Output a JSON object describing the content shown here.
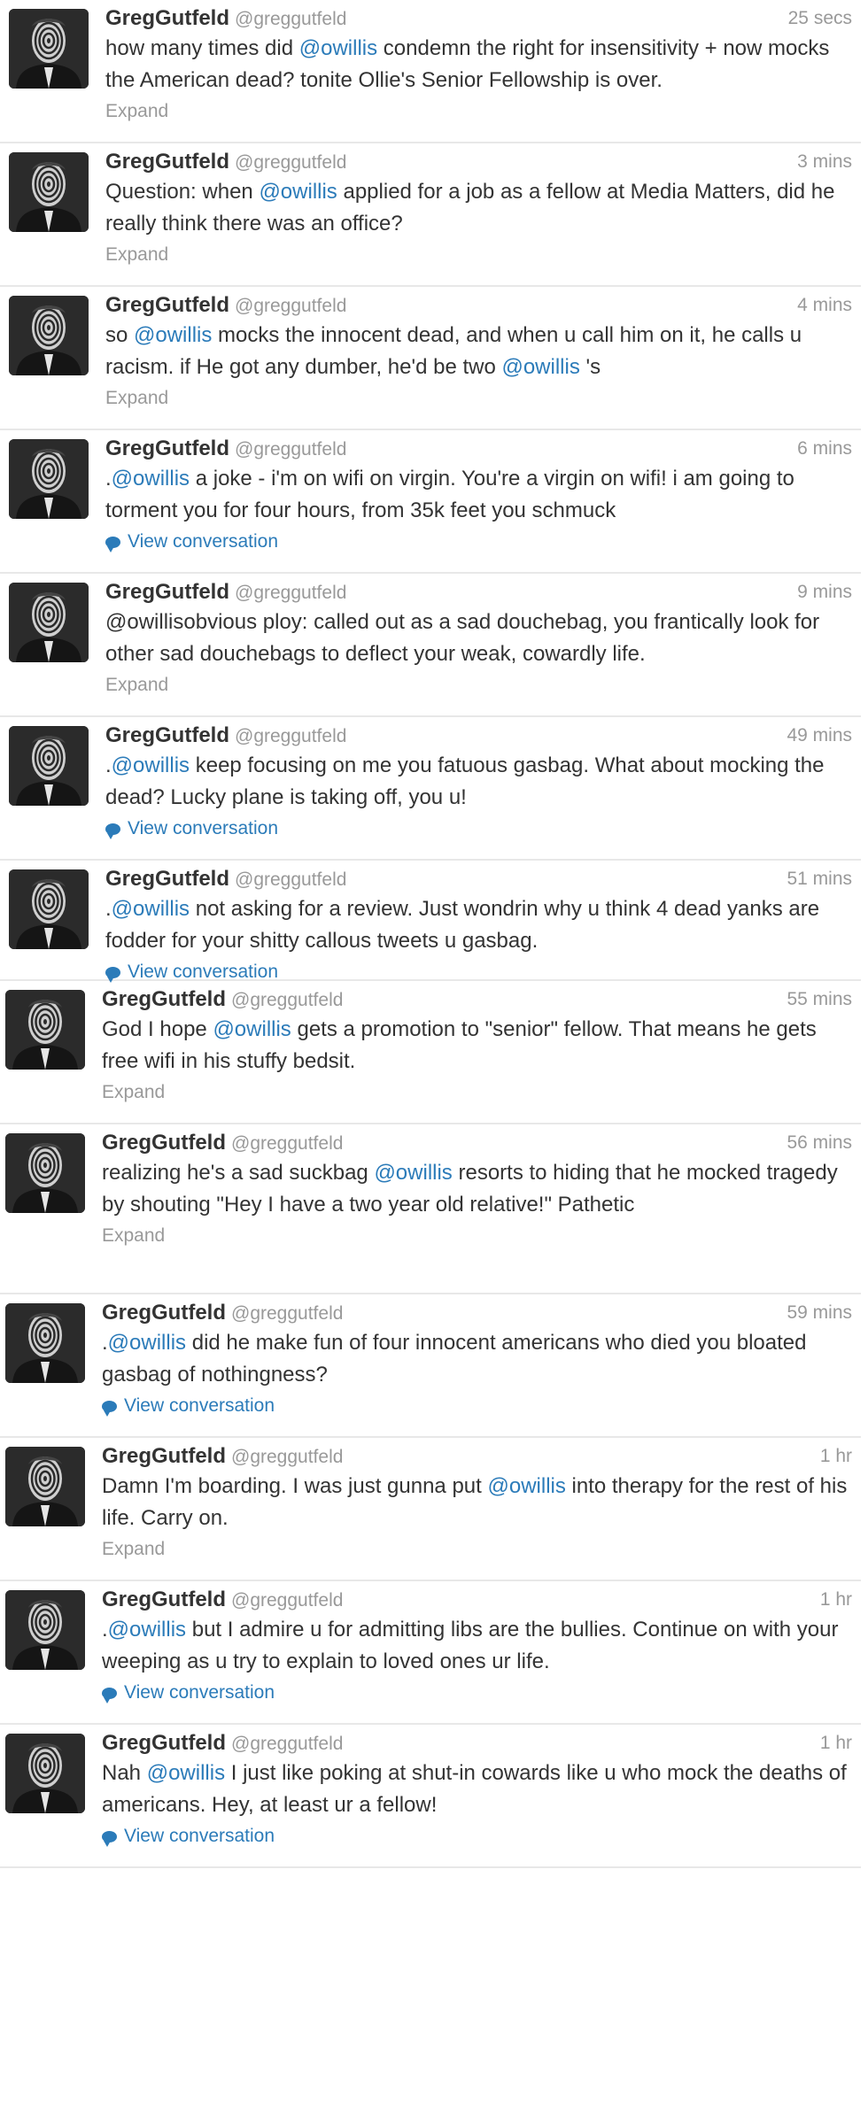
{
  "icons": {
    "avatar": "greg-gutfeld-hypnotic-portrait",
    "conversation": "speech-bubble-icon"
  },
  "colors": {
    "link": "#2b7bb9",
    "muted": "#999999",
    "text": "#333333"
  },
  "tweets": [
    {
      "name": "GregGutfeld",
      "handle": "@greggutfeld",
      "time": "25 secs",
      "segments": [
        {
          "t": "text",
          "v": "how many times did "
        },
        {
          "t": "mention",
          "v": "@owillis"
        },
        {
          "t": "text",
          "v": " condemn the right for insensitivity + now mocks the American dead? tonite Ollie's Senior Fellowship is over."
        }
      ],
      "action": "Expand",
      "action_type": "expand"
    },
    {
      "name": "GregGutfeld",
      "handle": "@greggutfeld",
      "time": "3 mins",
      "segments": [
        {
          "t": "text",
          "v": "Question: when "
        },
        {
          "t": "mention",
          "v": "@owillis"
        },
        {
          "t": "text",
          "v": " applied for a job as a fellow at Media Matters, did he really think there was an office?"
        }
      ],
      "action": "Expand",
      "action_type": "expand"
    },
    {
      "name": "GregGutfeld",
      "handle": "@greggutfeld",
      "time": "4 mins",
      "segments": [
        {
          "t": "text",
          "v": "so "
        },
        {
          "t": "mention",
          "v": "@owillis"
        },
        {
          "t": "text",
          "v": " mocks the innocent dead, and when u call him on it, he calls u racism. if He got any dumber, he'd be two "
        },
        {
          "t": "mention",
          "v": "@owillis"
        },
        {
          "t": "text",
          "v": " 's"
        }
      ],
      "action": "Expand",
      "action_type": "expand"
    },
    {
      "name": "GregGutfeld",
      "handle": "@greggutfeld",
      "time": "6 mins",
      "segments": [
        {
          "t": "text",
          "v": "."
        },
        {
          "t": "mention",
          "v": "@owillis"
        },
        {
          "t": "text",
          "v": " a joke - i'm on wifi on virgin. You're a virgin on wifi! i am going to torment you for four hours, from 35k feet you schmuck"
        }
      ],
      "action": "View conversation",
      "action_type": "conversation"
    },
    {
      "name": "GregGutfeld",
      "handle": "@greggutfeld",
      "time": "9 mins",
      "segments": [
        {
          "t": "text",
          "v": "@owillisobvious ploy: called out as a sad douchebag, you frantically look for other sad douchebags to deflect your weak, cowardly life."
        }
      ],
      "action": "Expand",
      "action_type": "expand"
    },
    {
      "name": "GregGutfeld",
      "handle": "@greggutfeld",
      "time": "49 mins",
      "segments": [
        {
          "t": "text",
          "v": "."
        },
        {
          "t": "mention",
          "v": "@owillis"
        },
        {
          "t": "text",
          "v": " keep focusing on me you fatuous gasbag. What about mocking the dead? Lucky plane is taking off, you u!"
        }
      ],
      "action": "View conversation",
      "action_type": "conversation"
    },
    {
      "name": "GregGutfeld",
      "handle": "@greggutfeld",
      "time": "51 mins",
      "segments": [
        {
          "t": "text",
          "v": "."
        },
        {
          "t": "mention",
          "v": "@owillis"
        },
        {
          "t": "text",
          "v": " not asking for a review. Just wondrin why u think 4 dead yanks are fodder for your shitty callous tweets u gasbag."
        }
      ],
      "action": "View conversation",
      "action_type": "conversation"
    },
    {
      "name": "GregGutfeld",
      "handle": "@greggutfeld",
      "time": "55 mins",
      "segments": [
        {
          "t": "text",
          "v": "God I hope "
        },
        {
          "t": "mention",
          "v": "@owillis"
        },
        {
          "t": "text",
          "v": " gets a promotion to \"senior\" fellow. That means he gets free wifi in his stuffy bedsit."
        }
      ],
      "action": "Expand",
      "action_type": "expand"
    },
    {
      "name": "GregGutfeld",
      "handle": "@greggutfeld",
      "time": "56 mins",
      "segments": [
        {
          "t": "text",
          "v": "realizing he's a sad suckbag "
        },
        {
          "t": "mention",
          "v": "@owillis"
        },
        {
          "t": "text",
          "v": " resorts to hiding that he mocked tragedy by shouting \"Hey I have a two year old relative!\" Pathetic"
        }
      ],
      "action": "Expand",
      "action_type": "expand"
    },
    {
      "name": "GregGutfeld",
      "handle": "@greggutfeld",
      "time": "59 mins",
      "segments": [
        {
          "t": "text",
          "v": "."
        },
        {
          "t": "mention",
          "v": "@owillis"
        },
        {
          "t": "text",
          "v": " did he make fun of four innocent americans who died you bloated gasbag of nothingness?"
        }
      ],
      "action": "View conversation",
      "action_type": "conversation"
    },
    {
      "name": "GregGutfeld",
      "handle": "@greggutfeld",
      "time": "1 hr",
      "segments": [
        {
          "t": "text",
          "v": "Damn I'm boarding. I was just gunna put "
        },
        {
          "t": "mention",
          "v": "@owillis"
        },
        {
          "t": "text",
          "v": " into therapy for the rest of his life. Carry on."
        }
      ],
      "action": "Expand",
      "action_type": "expand"
    },
    {
      "name": "GregGutfeld",
      "handle": "@greggutfeld",
      "time": "1 hr",
      "segments": [
        {
          "t": "text",
          "v": "."
        },
        {
          "t": "mention",
          "v": "@owillis"
        },
        {
          "t": "text",
          "v": " but I admire u for admitting libs are the bullies. Continue on with your weeping as u try to explain to loved ones ur life."
        }
      ],
      "action": "View conversation",
      "action_type": "conversation"
    },
    {
      "name": "GregGutfeld",
      "handle": "@greggutfeld",
      "time": "1 hr",
      "segments": [
        {
          "t": "text",
          "v": "Nah "
        },
        {
          "t": "mention",
          "v": "@owillis"
        },
        {
          "t": "text",
          "v": " I just like poking at shut-in cowards like u who mock the deaths of americans. Hey, at least ur a fellow!"
        }
      ],
      "action": "View conversation",
      "action_type": "conversation"
    }
  ]
}
